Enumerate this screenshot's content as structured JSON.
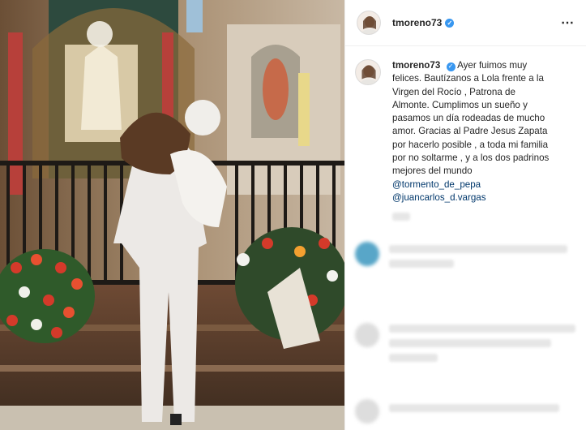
{
  "post": {
    "username": "tmoreno73",
    "verified": true,
    "more_icon": "⋯",
    "caption": {
      "username": "tmoreno73",
      "line1": "Ayer fuimos muy",
      "line2": "felices. Bautízanos a Lola frente a la",
      "line3": "Virgen del Rocío , Patrona de",
      "line4": "Almonte. Cumplimos un sueño y",
      "line5": "pasamos un día rodeadas de mucho",
      "line6": "amor. Gracias al Padre Jesus Zapata",
      "line7": "por hacerlo posible , a toda mi familia",
      "line8": "por no soltarme , y a los dos padrinos",
      "line9": "mejores del mundo",
      "mention1": "@tormento_de_pepa",
      "mention2": "@juancarlos_d.vargas"
    }
  },
  "colors": {
    "verified_blue": "#3897f0",
    "mention_blue": "#00376b",
    "border": "#efefef"
  }
}
